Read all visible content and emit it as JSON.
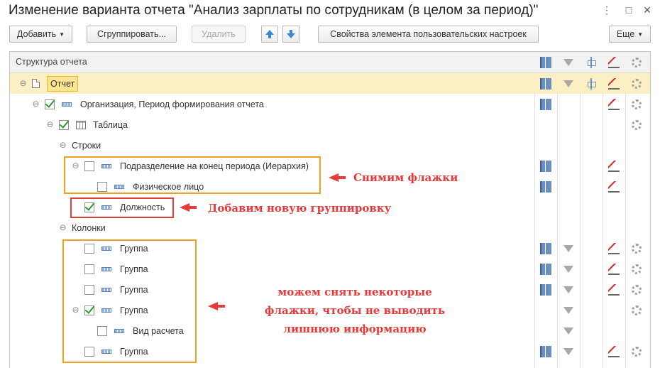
{
  "window": {
    "title": "Изменение варианта отчета \"Анализ зарплаты по сотрудникам (в целом за период)\"",
    "menu_icon": "⋮",
    "maximize_icon": "□",
    "close_icon": "✕"
  },
  "toolbar": {
    "add_label": "Добавить",
    "group_label": "Сгруппировать...",
    "delete_label": "Удалить",
    "props_label": "Свойства элемента пользовательских настроек",
    "more_label": "Еще"
  },
  "grid": {
    "header": "Структура отчета",
    "rows": [
      {
        "label": "Отчет"
      },
      {
        "label": "Организация, Период формирования отчета"
      },
      {
        "label": "Таблица"
      },
      {
        "label": "Строки"
      },
      {
        "label": "Подразделение на конец периода (Иерархия)"
      },
      {
        "label": "Физическое лицо"
      },
      {
        "label": "Должность"
      },
      {
        "label": "Колонки"
      },
      {
        "label": "Группа"
      },
      {
        "label": "Группа"
      },
      {
        "label": "Группа"
      },
      {
        "label": "Группа"
      },
      {
        "label": "Вид расчета"
      },
      {
        "label": "Группа"
      }
    ]
  },
  "annotations": {
    "remove_flags": "Снимим флажки",
    "add_grouping": "Добавим новую группировку",
    "uncheck_some": "можем снять некоторые флажки, чтобы не выводить лишнюю информацию"
  },
  "colors": {
    "selected_row": "#fbf0c4",
    "annotation_red": "#e83a3a",
    "annotation_orange": "#f0a020"
  }
}
